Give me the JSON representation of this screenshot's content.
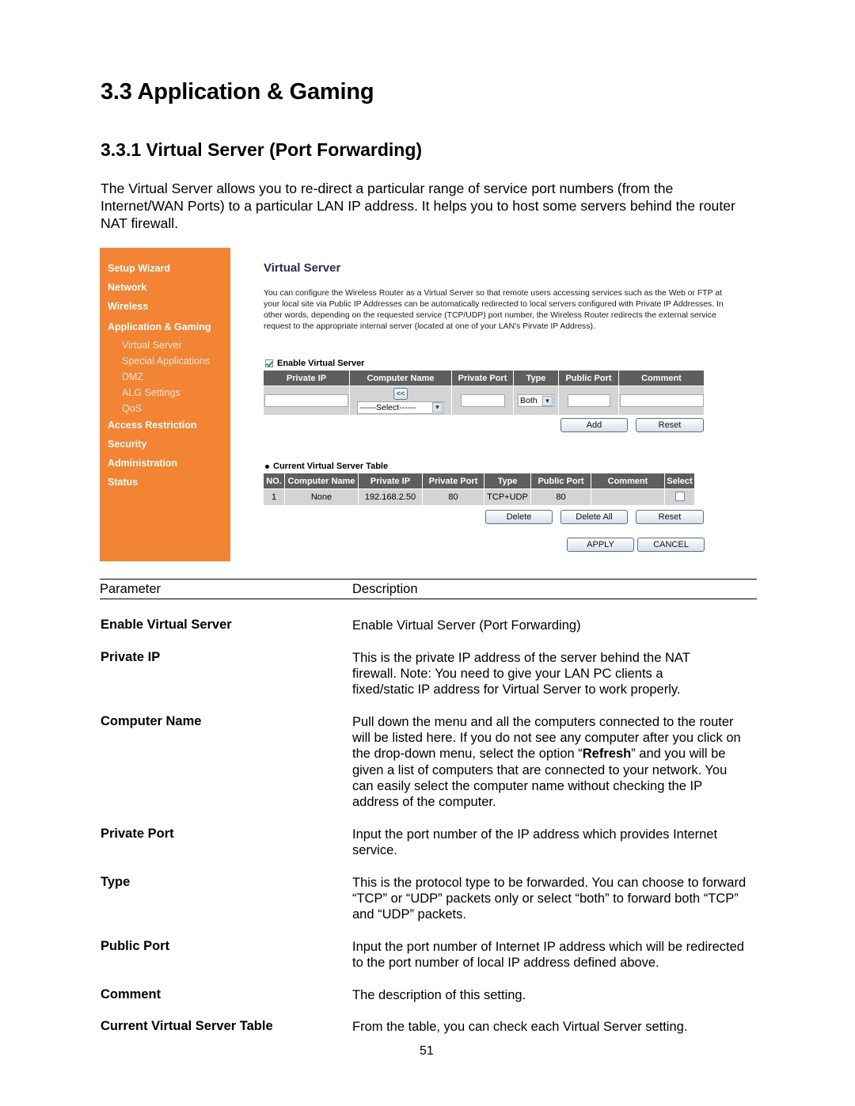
{
  "document": {
    "section_title": "3.3 Application & Gaming",
    "subsection_title": "3.3.1 Virtual Server (Port Forwarding)",
    "intro": "The Virtual Server allows you to re-direct a particular range of service port numbers (from the Internet/WAN Ports) to a particular LAN IP address. It helps you to host some servers behind the router NAT firewall.",
    "page_number": "51"
  },
  "router_ui": {
    "sidebar": {
      "bg_color": "#f28434",
      "items": [
        {
          "label": "Setup Wizard"
        },
        {
          "label": "Network"
        },
        {
          "label": "Wireless"
        },
        {
          "label": "Application & Gaming"
        },
        {
          "label": "Access Restriction"
        },
        {
          "label": "Security"
        },
        {
          "label": "Administration"
        },
        {
          "label": "Status"
        }
      ],
      "subitems": [
        {
          "label": "Virtual Server"
        },
        {
          "label": "Special Applications"
        },
        {
          "label": "DMZ"
        },
        {
          "label": "ALG Settings"
        },
        {
          "label": "QoS"
        }
      ]
    },
    "title": "Virtual Server",
    "description": "You can configure the Wireless Router as a Virtual Server so that remote users accessing services such as the Web or FTP at your local site via Public IP Addresses can be automatically redirected to local servers configured with Private IP Addresses. In other words, depending on the requested service (TCP/UDP) port number, the Wireless Router redirects the external service request to the appropriate internal server (located at one of your LAN's Pirvate IP Address).",
    "enable_label": "Enable Virtual Server",
    "enable_checked": true,
    "form": {
      "headers": [
        "Private IP",
        "Computer Name",
        "Private Port",
        "Type",
        "Public Port",
        "Comment"
      ],
      "private_ip_value": "",
      "copy_button": "<<",
      "computer_select": "------Select------",
      "private_port_value": "",
      "type_select": "Both",
      "public_port_value": "",
      "comment_value": "",
      "add_button": "Add",
      "reset_button": "Reset"
    },
    "current_table": {
      "title": "Current Virtual Server Table",
      "headers": [
        "NO.",
        "Computer Name",
        "Private IP",
        "Private Port",
        "Type",
        "Public Port",
        "Comment",
        "Select"
      ],
      "rows": [
        {
          "no": "1",
          "computer_name": "None",
          "private_ip": "192.168.2.50",
          "private_port": "80",
          "type": "TCP+UDP",
          "public_port": "80",
          "comment": "",
          "selected": false
        }
      ],
      "delete_button": "Delete",
      "delete_all_button": "Delete All",
      "reset_button": "Reset"
    },
    "apply_button": "APPLY",
    "cancel_button": "CANCEL",
    "header_color": "#5e5e5e",
    "cell_color": "#d4d4d4",
    "title_color": "#2b2b63"
  },
  "parameters": {
    "header_param": "Parameter",
    "header_desc": "Description",
    "rows": [
      {
        "name": "Enable Virtual Server",
        "desc": "Enable Virtual Server (Port Forwarding)"
      },
      {
        "name": "Private IP",
        "desc": "This is the private IP address of the server behind the NAT firewall. Note: You need to give your LAN PC clients a fixed/static IP address for Virtual Server to work properly."
      },
      {
        "name": "Computer Name",
        "desc_before": "Pull down the menu and all the computers connected to the router will be listed here. If you do not see any computer after you click on the drop-down menu, select the option “",
        "desc_bold": "Refresh",
        "desc_after": "” and you will be given a list of computers that are connected to your network. You can easily select the computer name without checking the IP address of the computer."
      },
      {
        "name": "Private Port",
        "desc": "Input the port number of the IP address which provides Internet service."
      },
      {
        "name": "Type",
        "desc": "This is the protocol type to be forwarded. You can choose to forward “TCP” or “UDP” packets only or select “both” to forward both “TCP” and “UDP” packets."
      },
      {
        "name": "Public Port",
        "desc": "Input the port number of Internet IP address which will be redirected to the port number of local IP address defined above."
      },
      {
        "name": "Comment",
        "desc": "The description of this setting."
      },
      {
        "name": "Current Virtual Server Table",
        "desc": "From the table, you can check each Virtual Server setting."
      }
    ]
  }
}
